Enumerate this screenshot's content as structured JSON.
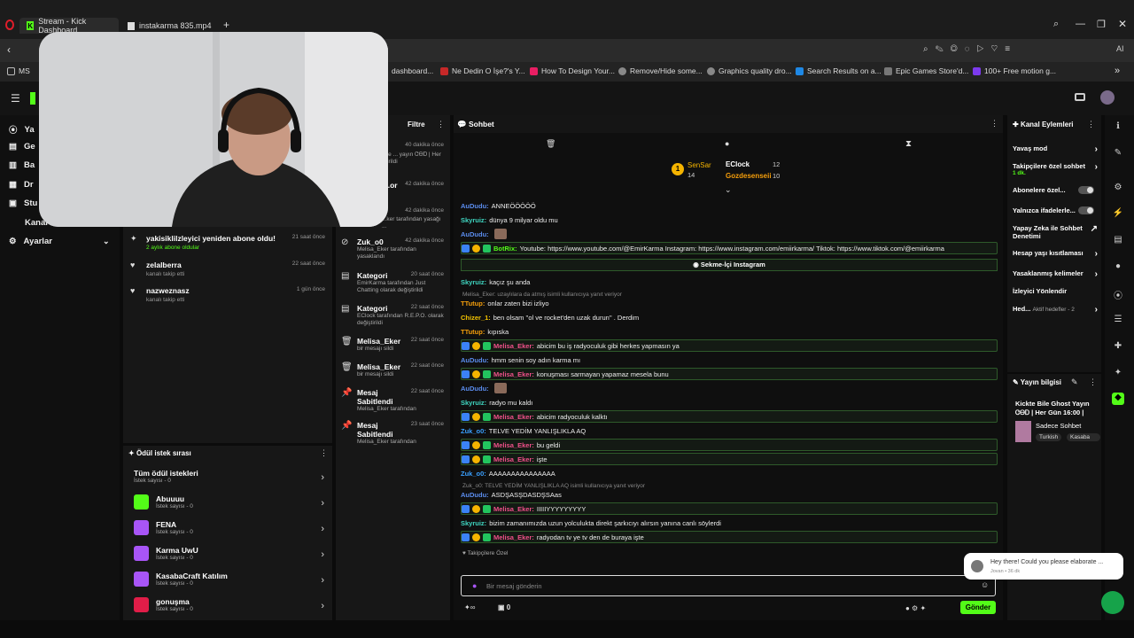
{
  "browser": {
    "tab1": "Stream - Kick Dashboard",
    "tab2": "instakarma 835.mp4",
    "new_tab": "+"
  },
  "bookmarks": {
    "ms": "MS",
    "items": [
      "dashboard...",
      "Ne Dedin O İşe?'s Y...",
      "How To Design Your...",
      "Remove/Hide some...",
      "Graphics quality dro...",
      "Search Results on a...",
      "Epic Games Store'd...",
      "100+ Free motion g..."
    ]
  },
  "leftnav": {
    "items": [
      "Ya",
      "Ge",
      "Ba",
      "Dr",
      "Stu",
      "Kanal",
      "Ayarlar"
    ]
  },
  "activity": {
    "items": [
      {
        "title": "yakisiklilzleyici yeniden abone oldu!",
        "sub": "2 aylık abone oldular",
        "time": "21 saat önce"
      },
      {
        "title": "zelalberra",
        "sub": "kanalı takip etti",
        "time": "22 saat önce"
      },
      {
        "title": "nazweznasz",
        "sub": "kanalı takip etti",
        "time": "1 gün önce"
      }
    ]
  },
  "modlog": {
    "filter": "Filtre",
    "items": [
      {
        "title": "",
        "time": "40 dakika önce",
        "sub": "tarafından Kickte ... yayın ᏣᎾᎠ | Her ... olarak değiştirildi"
      },
      {
        "title": "...or",
        "time": "42 dakika önce",
        "sub": ""
      },
      {
        "title": "",
        "time": "42 dakika önce",
        "sub": "...ker tarafından yasağı ..."
      },
      {
        "title": "Zuk_o0",
        "time": "42 dakika önce",
        "sub": "Melisa_Eker tarafından yasaklandı"
      },
      {
        "title": "Kategori",
        "time": "20 saat önce",
        "sub": "EmirKarma tarafından Just Chatting olarak değiştirildi"
      },
      {
        "title": "Kategori",
        "time": "22 saat önce",
        "sub": "EClock tarafından R.E.P.O. olarak değiştirildi"
      },
      {
        "title": "Melisa_Eker",
        "time": "22 saat önce",
        "sub": "bir mesajı sildi"
      },
      {
        "title": "Melisa_Eker",
        "time": "22 saat önce",
        "sub": "bir mesajı sildi"
      },
      {
        "title": "Mesaj Sabitlendi",
        "time": "22 saat önce",
        "sub": "Melisa_Eker tarafından"
      },
      {
        "title": "Mesaj Sabitlendi",
        "time": "23 saat önce",
        "sub": "Melisa_Eker tarafından"
      }
    ]
  },
  "rewards": {
    "title": "Ödül istek sırası",
    "all": "Tüm ödül istekleri",
    "all_sub": "İstek sayısı - 0",
    "items": [
      {
        "name": "Abuuuu",
        "sub": "İstek sayısı - 0",
        "color": "#53fc18"
      },
      {
        "name": "FENA",
        "sub": "İstek sayısı - 0",
        "color": "#a855f7"
      },
      {
        "name": "Karma UwU",
        "sub": "İstek sayısı - 0",
        "color": "#a855f7"
      },
      {
        "name": "KasabaCraft Katılım",
        "sub": "İstek sayısı - 0",
        "color": "#a855f7"
      },
      {
        "name": "gonuşma",
        "sub": "İstek sayısı - 0",
        "color": "#e11d48"
      }
    ]
  },
  "chat": {
    "title": "Sohbet",
    "leaders": {
      "first": "SenSar",
      "first_count": "14",
      "second": "EClock",
      "second_count": "12",
      "third": "Gozdesenseii",
      "third_count": "10",
      "rank": "1"
    },
    "messages": [
      {
        "u": "AuDudu",
        "c": "#5b8def",
        "t": "ANNEÖÖÖÖÖ"
      },
      {
        "u": "Skyruiz",
        "c": "#3fd7c2",
        "t": "dünya 9 milyar oldu mu"
      },
      {
        "u": "AuDudu",
        "c": "#5b8def",
        "t": ""
      },
      {
        "u": "BotRix",
        "c": "#53fc18",
        "t": "Youtube: https://www.youtube.com/@EmirKarma Instagram: https://www.instagram.com/emiirkarma/ Tiktok: https://www.tiktok.com/@emiirkarma"
      },
      {
        "u": "",
        "c": "#fff",
        "t": "Sekme-İçi Instagram"
      },
      {
        "u": "Skyruiz",
        "c": "#3fd7c2",
        "t": "kaçız şu anda"
      },
      {
        "u": "TTutup",
        "c": "#f59e0b",
        "t": "onlar zaten bizi izliyo"
      },
      {
        "u": "Chizer_1",
        "c": "#f5c400",
        "t": "ben olsam ''ol ve rocket'den uzak durun'' . Derdim"
      },
      {
        "u": "TTutup",
        "c": "#f59e0b",
        "t": "kıpıska"
      },
      {
        "u": "Melisa_Eker",
        "c": "#f0508a",
        "t": "abicim bu iş radyoculuk gibi herkes yapmasın ya"
      },
      {
        "u": "AuDudu",
        "c": "#5b8def",
        "t": "hmm senin soy adın karma mı"
      },
      {
        "u": "Melisa_Eker",
        "c": "#f0508a",
        "t": "konuşması sarmayan yapamaz mesela bunu"
      },
      {
        "u": "AuDudu",
        "c": "#5b8def",
        "t": ""
      },
      {
        "u": "Skyruiz",
        "c": "#3fd7c2",
        "t": "radyo mu kaldı"
      },
      {
        "u": "Melisa_Eker",
        "c": "#f0508a",
        "t": "abicim radyoculuk kalktı"
      },
      {
        "u": "Zuk_o0",
        "c": "#3aa0ff",
        "t": "TELVE YEDİM YANLIŞLIKLA AQ"
      },
      {
        "u": "Melisa_Eker",
        "c": "#f0508a",
        "t": "bu geldi"
      },
      {
        "u": "Melisa_Eker",
        "c": "#f0508a",
        "t": "işte"
      },
      {
        "u": "Zuk_o0",
        "c": "#3aa0ff",
        "t": "AAAAAAAAAAAAAAA"
      },
      {
        "u": "AuDudu",
        "c": "#5b8def",
        "t": "ASDŞASŞDASDŞSAas"
      },
      {
        "u": "Melisa_Eker",
        "c": "#f0508a",
        "t": "IIIIIYYYYYYYYY"
      },
      {
        "u": "Skyruiz",
        "c": "#3fd7c2",
        "t": "bizim zamanımızda uzun yolculukta direkt şarkıcıyı alırsın yanına canlı söylerdi"
      },
      {
        "u": "Melisa_Eker",
        "c": "#f0508a",
        "t": "radyodan tv ye tv den de buraya işte"
      }
    ],
    "reply1": "Melisa_Eker: uzaylılara da atmış isimli kullanıcıya yanıt veriyor",
    "reply2": "Zuk_o0: TELVE YEDİM YANLIŞLIKLA AQ isimli kullanıcıya yanıt veriyor",
    "subs_only": "Takipçilere Özel",
    "input_placeholder": "Bir mesaj gönderin",
    "points": "0",
    "send": "Gönder"
  },
  "chanact": {
    "title": "Kanal Eylemleri",
    "items": [
      "Yavaş mod",
      "Takipçilere özel sohbet",
      "Abonelere özel...",
      "Yalnızca ifadelerle...",
      "Yapay Zeka ile Sohbet Denetimi",
      "Hesap yaşı kısıtlaması",
      "Yasaklanmış kelimeler",
      "İzleyici Yönlendir",
      "Hed..."
    ],
    "follow_sub": "1 dk.",
    "goals_sub": "Aktif hedefler - 2"
  },
  "streaminfo": {
    "title": "Yayın bilgisi",
    "stream_title": "Kickte Bile Ghost Yayın ᏣᎾᎠ | Her Gün 16:00 |",
    "category": "Sadece Sohbet",
    "tags": [
      "Turkish",
      "Kasaba"
    ]
  },
  "toast": {
    "text": "Hey there!  Could you please elaborate ...",
    "sub": "Jovan • 36 dk"
  }
}
